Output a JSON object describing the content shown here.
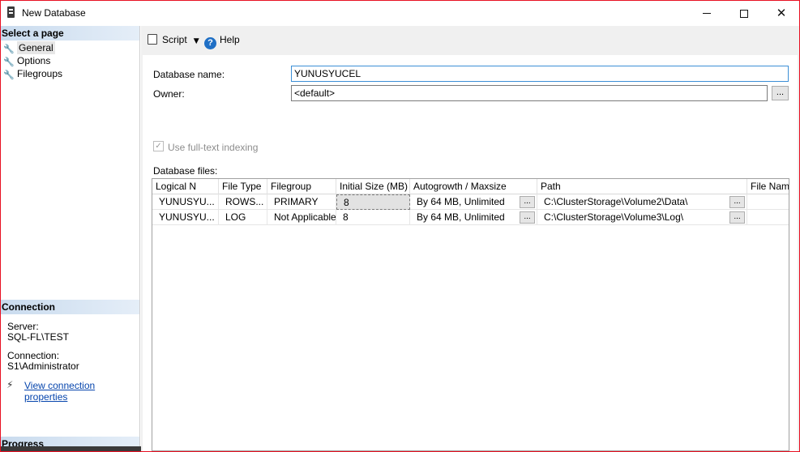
{
  "window": {
    "title": "New Database",
    "controls": {
      "close": "✕"
    }
  },
  "leftpane": {
    "select_header": "Select a page",
    "pages": [
      {
        "label": "General",
        "selected": true
      },
      {
        "label": "Options",
        "selected": false
      },
      {
        "label": "Filegroups",
        "selected": false
      }
    ],
    "connection_header": "Connection",
    "server_label": "Server:",
    "server_value": "SQL-FL\\TEST",
    "connection_label": "Connection:",
    "connection_value": "S1\\Administrator",
    "view_link": "View connection properties",
    "progress_header": "Progress"
  },
  "toolbar": {
    "script_label": "Script",
    "help_label": "Help",
    "help_icon_text": "?"
  },
  "form": {
    "db_name_label": "Database name:",
    "db_name_value": "YUNUSYUCEL",
    "owner_label": "Owner:",
    "owner_value": "<default>",
    "owner_button": "...",
    "fulltext_label": "Use full-text indexing",
    "fulltext_checked": true,
    "files_label": "Database files:"
  },
  "grid": {
    "columns": [
      "Logical N",
      "File Type",
      "Filegroup",
      "Initial Size (MB)",
      "Autogrowth / Maxsize",
      "Path",
      "File Name"
    ],
    "rows": [
      {
        "logical": "YUNUSYU...",
        "type": "ROWS...",
        "filegroup": "PRIMARY",
        "size": "8",
        "autogrowth": "By 64 MB, Unlimited",
        "path": "C:\\ClusterStorage\\Volume2\\Data\\",
        "file_name": ""
      },
      {
        "logical": "YUNUSYU...",
        "type": "LOG",
        "filegroup": "Not Applicable",
        "size": "8",
        "autogrowth": "By 64 MB, Unlimited",
        "path": "C:\\ClusterStorage\\Volume3\\Log\\",
        "file_name": ""
      }
    ],
    "cell_button": "..."
  },
  "colors": {
    "accent": "#e81123",
    "header_gradient_start": "#c9dbee",
    "link": "#0645ad"
  },
  "icons": [
    "database-icon",
    "wrench-icon",
    "script-icon",
    "help-icon",
    "plug-icon",
    "checkbox-icon"
  ]
}
